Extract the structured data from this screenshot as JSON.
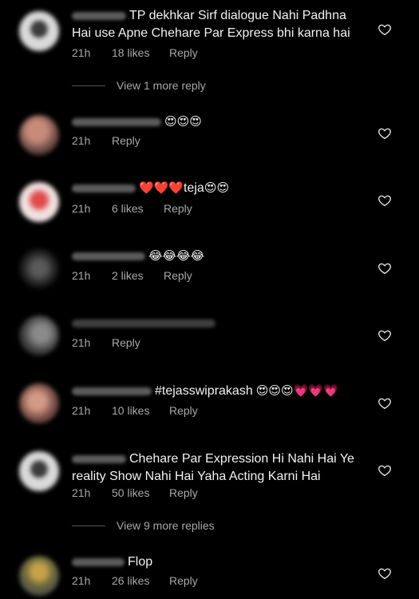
{
  "comments": [
    {
      "text_line1": "TP dekhkar Sirf dialogue Nahi Padhna",
      "text_line2": "Hai use Apne Chehare Par Express bhi karna hai",
      "time": "21h",
      "likes": "18 likes",
      "reply": "Reply"
    },
    {
      "emoji": "😍😍😍",
      "time": "21h",
      "reply": "Reply"
    },
    {
      "emoji": "❤️❤️❤️",
      "text": "teja",
      "emoji2": "😍😍",
      "time": "21h",
      "likes": "6 likes",
      "reply": "Reply"
    },
    {
      "emoji": "😂😂😂😂",
      "time": "21h",
      "likes": "2 likes",
      "reply": "Reply"
    },
    {
      "time": "21h",
      "reply": "Reply"
    },
    {
      "text": "#tejasswiprakash",
      "emoji": "😍😍😍💗💗💗",
      "time": "21h",
      "likes": "10 likes",
      "reply": "Reply"
    },
    {
      "text_line1": "Chehare Par Expression Hi Nahi Hai Ye",
      "text_line2": "reality Show Nahi Hai Yaha Acting Karni Hai",
      "time": "21h",
      "likes": "50 likes",
      "reply": "Reply"
    },
    {
      "text": "Flop",
      "time": "21h",
      "likes": "26 likes",
      "reply": "Reply"
    }
  ],
  "view_more_1": "View 1 more reply",
  "view_more_2": "View 9 more replies",
  "colors": {
    "background": "#000000",
    "secondary_text": "#a8a8a8"
  },
  "icons": {
    "heart": "heart-outline-icon"
  }
}
